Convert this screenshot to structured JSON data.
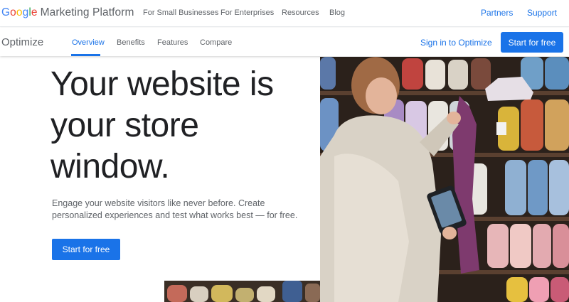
{
  "topbar": {
    "brand_google": [
      "G",
      "o",
      "o",
      "g",
      "l",
      "e"
    ],
    "brand_rest": "Marketing Platform",
    "nav": [
      "For Small Businesses",
      "For Enterprises",
      "Resources",
      "Blog"
    ],
    "right_links": [
      "Partners",
      "Support"
    ]
  },
  "productbar": {
    "product_name": "Optimize",
    "tabs": [
      "Overview",
      "Benefits",
      "Features",
      "Compare"
    ],
    "active_tab": "Overview",
    "sign_in": "Sign in to Optimize",
    "start_button": "Start for free"
  },
  "hero": {
    "title": "Your website is your store window.",
    "description": "Engage your website visitors like never before. Create personalized experiences and test what works best — for free.",
    "cta": "Start for free",
    "image": "woman-browsing-yarn-shelves-with-tablet-photo"
  },
  "colors": {
    "accent": "#1a73e8",
    "text": "#202124",
    "muted": "#5f6368"
  }
}
